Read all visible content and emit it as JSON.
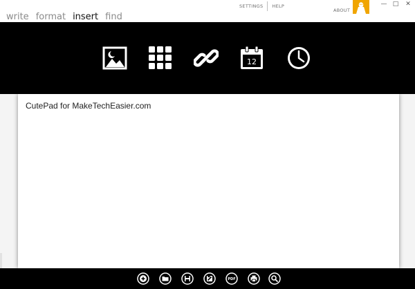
{
  "menu": {
    "items": [
      {
        "label": "write",
        "active": false
      },
      {
        "label": "format",
        "active": false
      },
      {
        "label": "insert",
        "active": true
      },
      {
        "label": "find",
        "active": false
      }
    ]
  },
  "top_links": {
    "settings": "SETTINGS",
    "help": "HELP",
    "about": "ABOUT"
  },
  "window_controls": {
    "minimize": "—",
    "maximize": "□",
    "close": "✕"
  },
  "ribbon": {
    "icons": [
      "image-icon",
      "table-grid-icon",
      "link-icon",
      "calendar-icon",
      "clock-icon"
    ],
    "calendar_day": "12"
  },
  "editor": {
    "content": "CutePad for MakeTechEasier.com"
  },
  "bottom_toolbar": {
    "icons": [
      "new-icon",
      "open-folder-icon",
      "save-icon",
      "save-as-icon",
      "pdf-icon",
      "print-icon",
      "search-icon"
    ],
    "pdf_label": "PDF"
  },
  "colors": {
    "ribbon_bg": "#000000",
    "logo_accent": "#f0a500",
    "active_menu": "#111111",
    "inactive_menu": "#8a8a8a"
  }
}
